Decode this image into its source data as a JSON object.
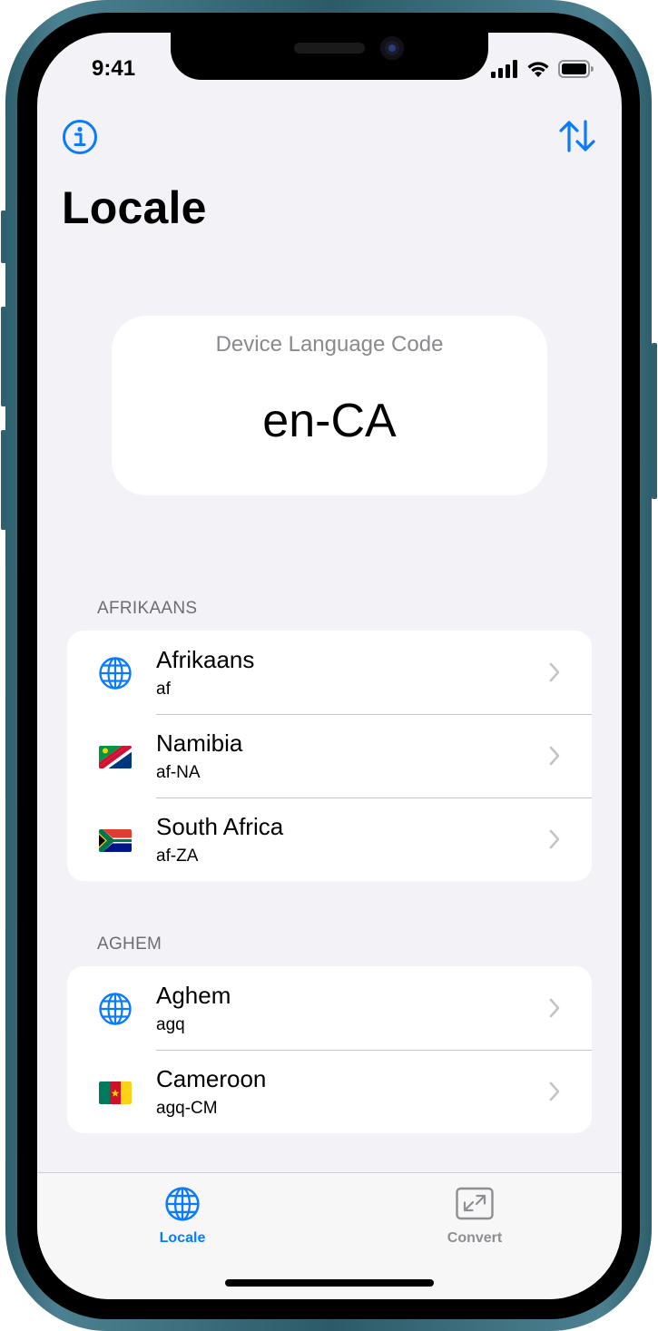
{
  "status_bar": {
    "time": "9:41"
  },
  "nav": {
    "title": "Locale",
    "info_icon": "info-circle-icon",
    "sort_icon": "arrow-up-down-icon"
  },
  "device_card": {
    "label": "Device Language Code",
    "code": "en-CA"
  },
  "sections": [
    {
      "header": "AFRIKAANS",
      "rows": [
        {
          "icon": "globe-icon",
          "title": "Afrikaans",
          "code": "af"
        },
        {
          "icon": "flag-namibia",
          "title": "Namibia",
          "code": "af-NA"
        },
        {
          "icon": "flag-south-africa",
          "title": "South Africa",
          "code": "af-ZA"
        }
      ]
    },
    {
      "header": "AGHEM",
      "rows": [
        {
          "icon": "globe-icon",
          "title": "Aghem",
          "code": "agq"
        },
        {
          "icon": "flag-cameroon",
          "title": "Cameroon",
          "code": "agq-CM"
        }
      ]
    }
  ],
  "tab_bar": {
    "tabs": [
      {
        "label": "Locale",
        "icon": "globe-icon",
        "selected": true
      },
      {
        "label": "Convert",
        "icon": "convert-icon",
        "selected": false
      }
    ]
  },
  "colors": {
    "accent": "#0a7aff",
    "background": "#f2f2f7",
    "inactive": "#8e8e93"
  }
}
